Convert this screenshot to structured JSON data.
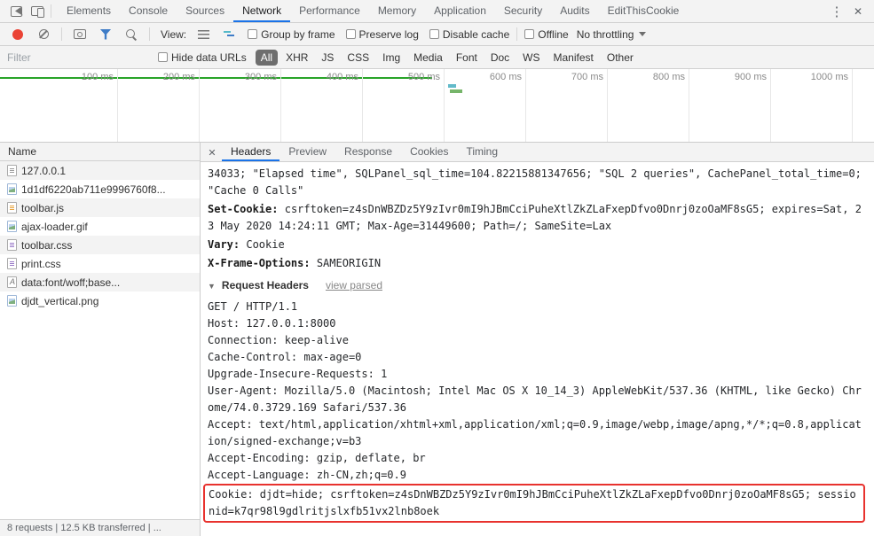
{
  "colors": {
    "accent_blue": "#1a73e8",
    "record_red": "#ea4335",
    "filter_blue": "#3e7cc7",
    "annotation_red": "#e8322e",
    "timeline_green": "#28a428",
    "badge_gray": "#6e6e6e"
  },
  "main_tabs": [
    {
      "label": "Elements"
    },
    {
      "label": "Console"
    },
    {
      "label": "Sources"
    },
    {
      "label": "Network",
      "active": true
    },
    {
      "label": "Performance"
    },
    {
      "label": "Memory"
    },
    {
      "label": "Application"
    },
    {
      "label": "Security"
    },
    {
      "label": "Audits"
    },
    {
      "label": "EditThisCookie"
    }
  ],
  "toolbar": {
    "view_label": "View:",
    "checkboxes": [
      {
        "label": "Group by frame",
        "checked": false
      },
      {
        "label": "Preserve log",
        "checked": false
      },
      {
        "label": "Disable cache",
        "checked": false
      }
    ],
    "offline_label": "Offline",
    "throttling_value": "No throttling"
  },
  "filter_bar": {
    "placeholder": "Filter",
    "hide_data_urls_label": "Hide data URLs",
    "types": [
      {
        "label": "All",
        "active": true
      },
      {
        "label": "XHR"
      },
      {
        "label": "JS"
      },
      {
        "label": "CSS"
      },
      {
        "label": "Img"
      },
      {
        "label": "Media"
      },
      {
        "label": "Font"
      },
      {
        "label": "Doc"
      },
      {
        "label": "WS"
      },
      {
        "label": "Manifest"
      },
      {
        "label": "Other"
      }
    ]
  },
  "timeline": {
    "labels": [
      "100 ms",
      "200 ms",
      "300 ms",
      "400 ms",
      "500 ms",
      "600 ms",
      "700 ms",
      "800 ms",
      "900 ms",
      "1000 ms"
    ]
  },
  "requests": {
    "column_header": "Name",
    "rows": [
      {
        "name": "127.0.0.1",
        "icon": "document"
      },
      {
        "name": "1d1df6220ab711e9996760f8...",
        "icon": "image"
      },
      {
        "name": "toolbar.js",
        "icon": "script"
      },
      {
        "name": "ajax-loader.gif",
        "icon": "image"
      },
      {
        "name": "toolbar.css",
        "icon": "stylesheet"
      },
      {
        "name": "print.css",
        "icon": "stylesheet"
      },
      {
        "name": "data:font/woff;base...",
        "icon": "font"
      },
      {
        "name": "djdt_vertical.png",
        "icon": "image"
      }
    ]
  },
  "status_bar": {
    "text": "8 requests | 12.5 KB transferred | ..."
  },
  "details": {
    "tabs": [
      {
        "label": "Headers",
        "active": true
      },
      {
        "label": "Preview"
      },
      {
        "label": "Response"
      },
      {
        "label": "Cookies"
      },
      {
        "label": "Timing"
      }
    ],
    "headers": {
      "partial_response_line": "34033; \"Elapsed time\", SQLPanel_sql_time=104.82215881347656; \"SQL 2 queries\", CachePanel_total_time=0; \"Cache 0 Calls\"",
      "response_headers": [
        {
          "name": "Set-Cookie:",
          "value": "csrftoken=z4sDnWBZDz5Y9zIvr0mI9hJBmCciPuheXtlZkZLaFxepDfvo0Dnrj0zoOaMF8sG5; expires=Sat, 23 May 2020 14:24:11 GMT; Max-Age=31449600; Path=/; SameSite=Lax"
        },
        {
          "name": "Vary:",
          "value": "Cookie"
        },
        {
          "name": "X-Frame-Options:",
          "value": "SAMEORIGIN"
        }
      ],
      "request_headers_label": "Request Headers",
      "view_parsed_label": "view parsed",
      "request_raw_lines": [
        "GET / HTTP/1.1",
        "Host: 127.0.0.1:8000",
        "Connection: keep-alive",
        "Cache-Control: max-age=0",
        "Upgrade-Insecure-Requests: 1",
        "User-Agent: Mozilla/5.0 (Macintosh; Intel Mac OS X 10_14_3) AppleWebKit/537.36 (KHTML, like Gecko) Chrome/74.0.3729.169 Safari/537.36",
        "Accept: text/html,application/xhtml+xml,application/xml;q=0.9,image/webp,image/apng,*/*;q=0.8,application/signed-exchange;v=b3",
        "Accept-Encoding: gzip, deflate, br",
        "Accept-Language: zh-CN,zh;q=0.9"
      ],
      "highlighted_cookie_line": "Cookie: djdt=hide; csrftoken=z4sDnWBZDz5Y9zIvr0mI9hJBmCciPuheXtlZkZLaFxepDfvo0Dnrj0zoOaMF8sG5; sessionid=k7qr98l9gdlritjslxfb51vx2lnb8oek"
    }
  }
}
